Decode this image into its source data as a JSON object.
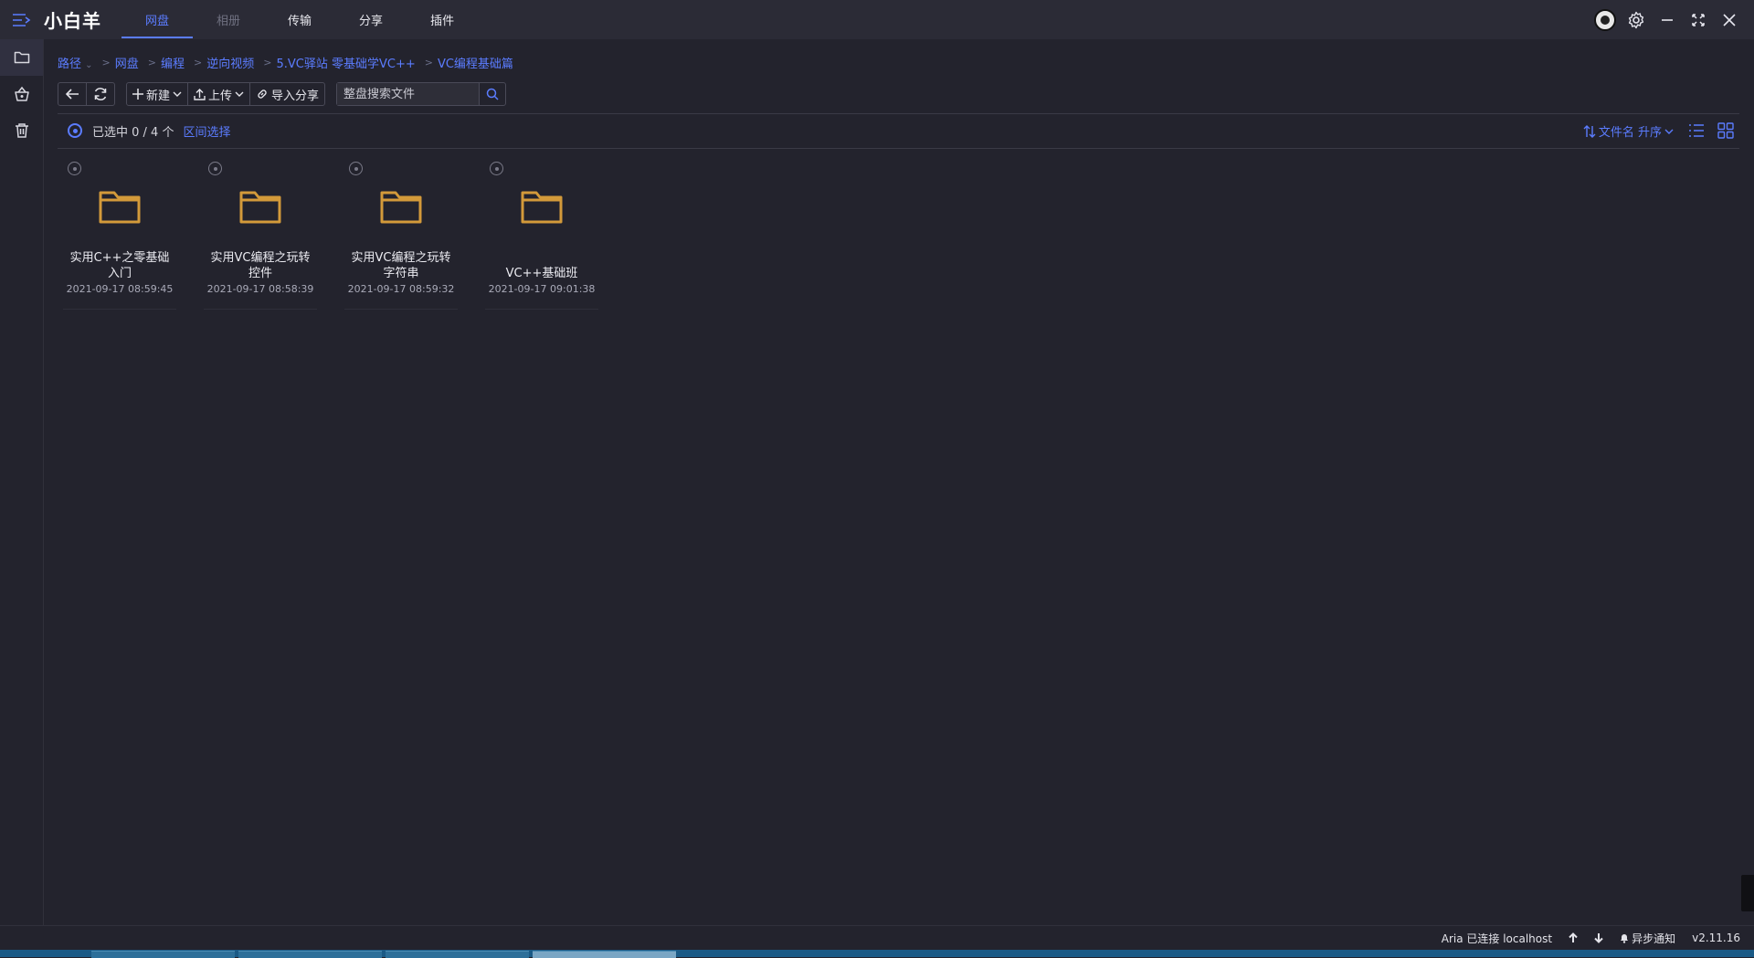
{
  "app": {
    "title": "小白羊"
  },
  "nav": {
    "tabs": [
      {
        "label": "网盘",
        "state": "active"
      },
      {
        "label": "相册",
        "state": "disabled"
      },
      {
        "label": "传输",
        "state": "normal"
      },
      {
        "label": "分享",
        "state": "normal"
      },
      {
        "label": "插件",
        "state": "normal"
      }
    ]
  },
  "window_controls": [
    "avatar",
    "settings-icon",
    "minimize-icon",
    "maximize-icon",
    "close-icon"
  ],
  "rail": {
    "items": [
      "folder-icon",
      "basket-icon",
      "trash-icon"
    ]
  },
  "breadcrumb": {
    "root": "路径",
    "items": [
      "网盘",
      "编程",
      "逆向视频",
      "5.VC驿站 零基础学VC++",
      "VC编程基础篇"
    ]
  },
  "toolbar": {
    "new_label": "新建",
    "upload_label": "上传",
    "import_label": "导入分享",
    "search_placeholder": "整盘搜索文件"
  },
  "selection": {
    "text": "已选中 0 / 4 个",
    "range_label": "区间选择"
  },
  "sort": {
    "label": "文件名 升序"
  },
  "files": [
    {
      "name": "实用C++之零基础入门",
      "date": "2021-09-17 08:59:45"
    },
    {
      "name": "实用VC编程之玩转控件",
      "date": "2021-09-17 08:58:39"
    },
    {
      "name": "实用VC编程之玩转字符串",
      "date": "2021-09-17 08:59:32"
    },
    {
      "name": "VC++基础班",
      "date": "2021-09-17 09:01:38"
    }
  ],
  "status": {
    "aria": "Aria 已连接 localhost",
    "notify": "异步通知",
    "version": "v2.11.16"
  },
  "colors": {
    "accent": "#5b7cff",
    "background": "#23232d",
    "titlebar": "#2b2b36",
    "folder": "#d39a3a"
  }
}
